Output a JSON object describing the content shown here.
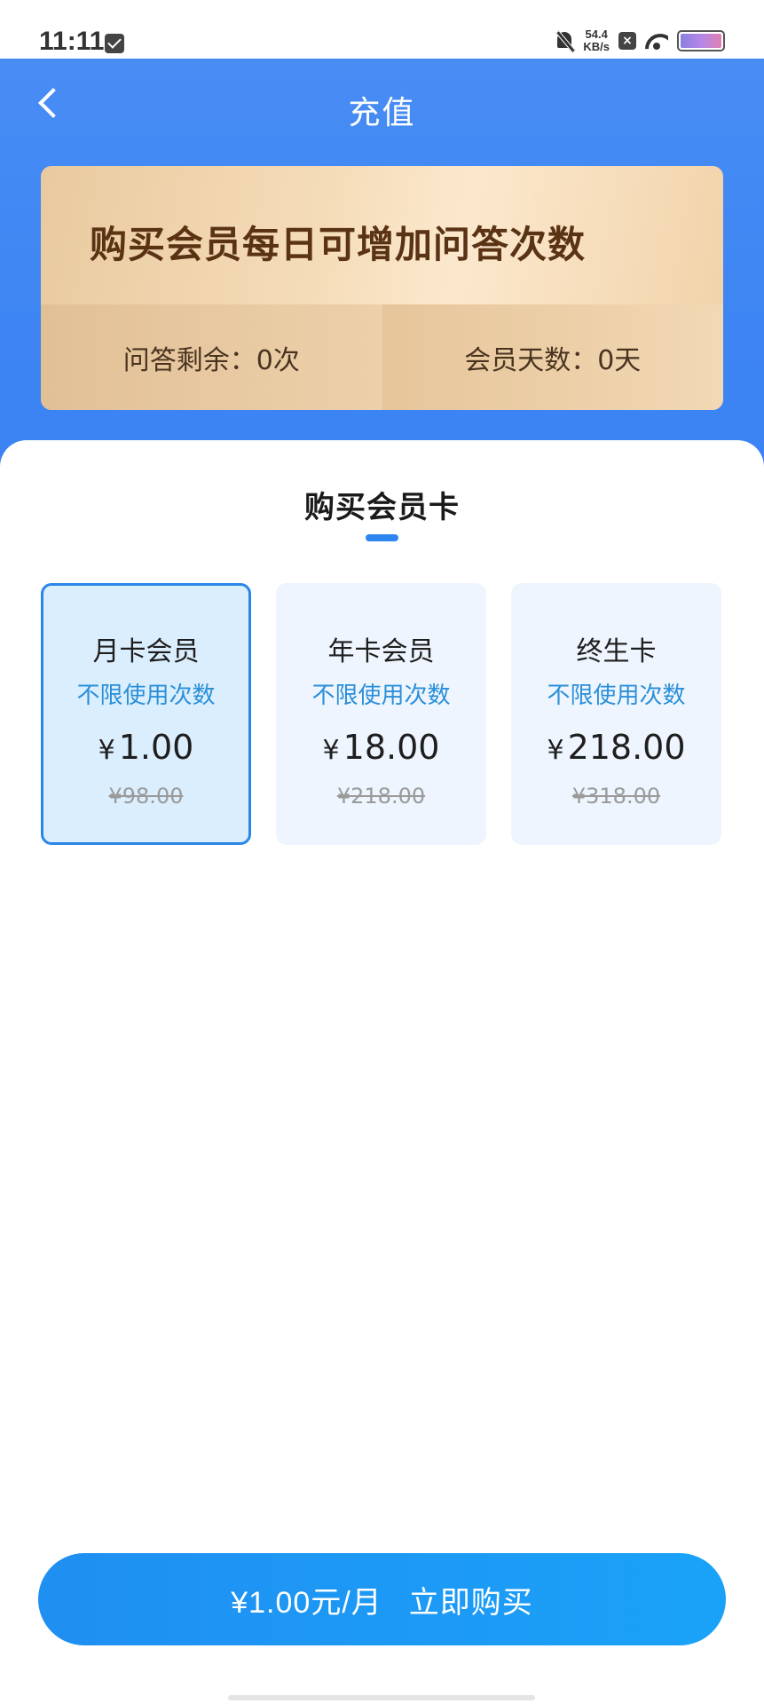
{
  "status_bar": {
    "time": "11:11",
    "net_speed_value": "54.4",
    "net_speed_unit": "KB/s"
  },
  "header": {
    "title": "充值"
  },
  "vip_card": {
    "headline": "购买会员每日可增加问答次数",
    "remaining_label": "问答剩余：0次",
    "days_label": "会员天数：0天"
  },
  "section": {
    "title": "购买会员卡"
  },
  "plans": [
    {
      "name": "月卡会员",
      "desc": "不限使用次数",
      "currency": "¥",
      "price": "1.00",
      "original": "¥98.00",
      "selected": true
    },
    {
      "name": "年卡会员",
      "desc": "不限使用次数",
      "currency": "¥",
      "price": "18.00",
      "original": "¥218.00",
      "selected": false
    },
    {
      "name": "终生卡",
      "desc": "不限使用次数",
      "currency": "¥",
      "price": "218.00",
      "original": "¥318.00",
      "selected": false
    }
  ],
  "buy_button": {
    "price_label": "¥1.00元/月",
    "action_label": "立即购买"
  },
  "colors": {
    "primary_blue": "#3f86f3",
    "accent_blue": "#2a86e8",
    "gold_text": "#5a3214"
  }
}
